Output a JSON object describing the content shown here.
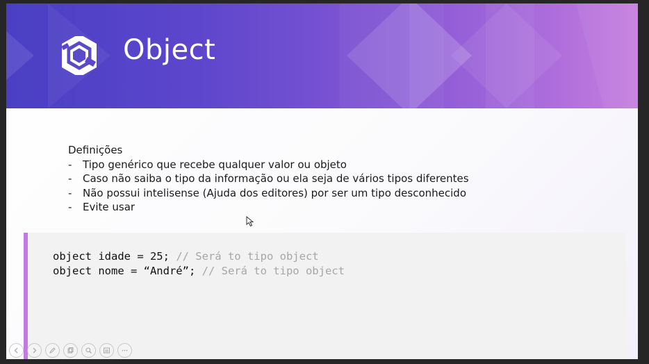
{
  "slide": {
    "title": "Object",
    "heading": "Definições",
    "bullets": [
      "Tipo genérico que recebe qualquer valor ou objeto",
      "Caso não saiba o tipo da informação ou ela seja de vários tipos diferentes",
      "Não possui intelisense (Ajuda dos editores) por ser um tipo desconhecido",
      "Evite usar"
    ],
    "bullet_marker": "-",
    "code": [
      {
        "code": "object idade = 25; ",
        "comment": "// Será to tipo object"
      },
      {
        "code": "object nome = “André”; ",
        "comment": "// Será to tipo object"
      }
    ]
  },
  "colors": {
    "banner_start": "#4a3fc4",
    "banner_end": "#c67fdf",
    "code_accent": "#c17ae0",
    "code_background": "#f2f2f2",
    "comment": "#a6a6a6"
  },
  "toolbar": {
    "buttons": [
      {
        "icon": "arrow-left-icon"
      },
      {
        "icon": "arrow-right-icon"
      },
      {
        "icon": "pen-icon"
      },
      {
        "icon": "copy-icon"
      },
      {
        "icon": "zoom-icon"
      },
      {
        "icon": "menu-icon"
      },
      {
        "icon": "more-icon"
      }
    ]
  }
}
